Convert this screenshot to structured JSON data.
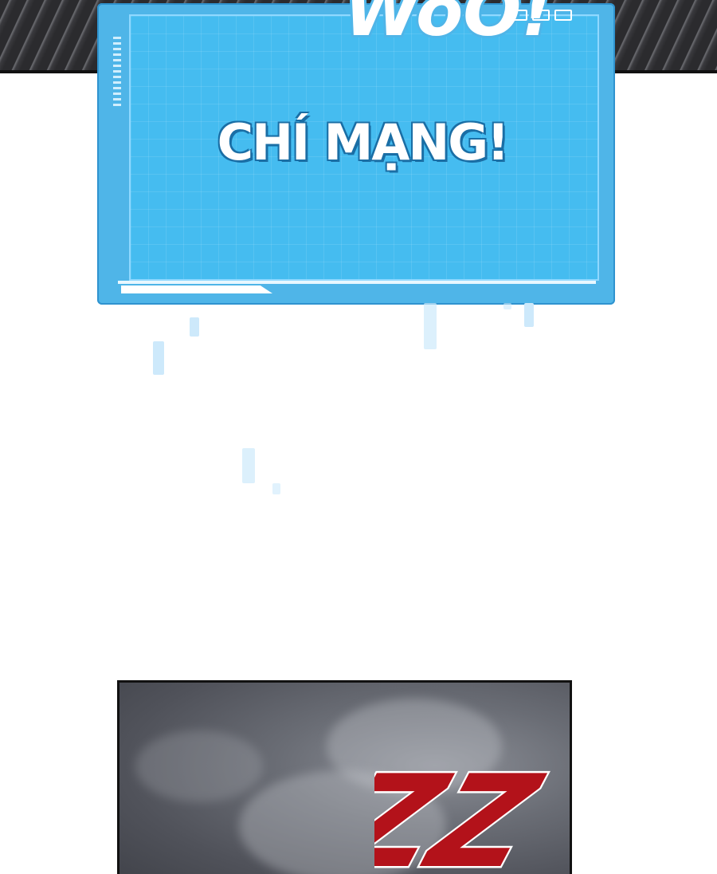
{
  "panel_top": {
    "sfx_text": "WoO!"
  },
  "system_window": {
    "title": "CHÍ MẠNG!",
    "window_buttons": [
      "minimize",
      "maximize",
      "close"
    ],
    "colors": {
      "frame": "#4fb5e8",
      "inner": "#45bcf0",
      "title_outline": "#1a6ea5"
    }
  },
  "panel_bottom": {
    "sfx_text": "ZZ"
  }
}
